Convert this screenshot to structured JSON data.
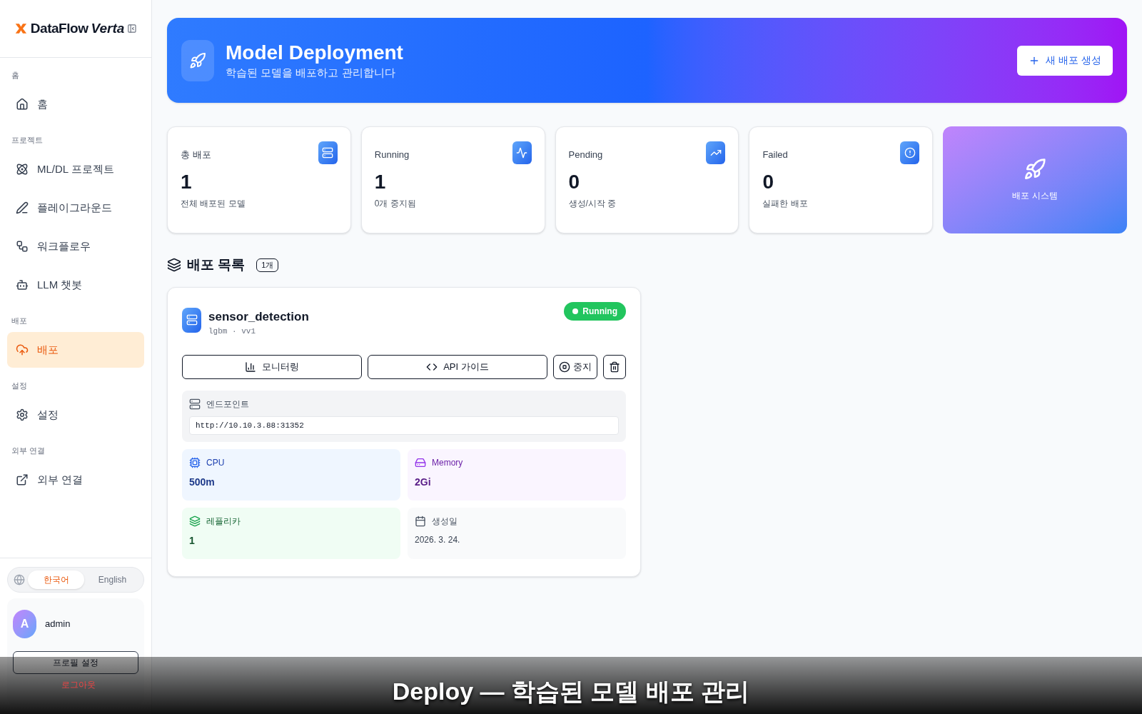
{
  "brand": {
    "name": "DataFlow",
    "accent": "Verta"
  },
  "sidebar": {
    "groups": [
      {
        "label": "홈",
        "items": [
          {
            "kind": "home",
            "label": "홈",
            "selected": false
          }
        ]
      },
      {
        "label": "프로젝트",
        "items": [
          {
            "kind": "atom",
            "label": "ML/DL 프로젝트",
            "selected": false
          },
          {
            "kind": "pen",
            "label": "플레이그라운드",
            "selected": false
          },
          {
            "kind": "flow",
            "label": "워크플로우",
            "selected": false
          },
          {
            "kind": "bot",
            "label": "LLM 챗봇",
            "selected": false
          }
        ]
      },
      {
        "label": "배포",
        "items": [
          {
            "kind": "upload",
            "label": "배포",
            "selected": true
          }
        ]
      },
      {
        "label": "설정",
        "items": [
          {
            "kind": "gear",
            "label": "설정",
            "selected": false
          }
        ]
      },
      {
        "label": "외부 연결",
        "items": [
          {
            "kind": "link",
            "label": "외부 연결",
            "selected": false
          }
        ]
      }
    ]
  },
  "languages": [
    {
      "label": "한국어",
      "selected": true
    },
    {
      "label": "English",
      "selected": false
    }
  ],
  "user": {
    "initial": "A",
    "name": "admin",
    "profile_button": "프로필 설정",
    "logout": "로그아웃"
  },
  "header": {
    "title": "Model Deployment",
    "subtitle": "학습된 모델을 배포하고 관리합니다",
    "new_button": "새 배포 생성"
  },
  "stats": [
    {
      "kind": "server",
      "label": "총 배포",
      "value": "1",
      "note": "전체 배포된 모델"
    },
    {
      "kind": "activity",
      "label": "Running",
      "value": "1",
      "note": "0개 중지됨"
    },
    {
      "kind": "trend",
      "label": "Pending",
      "value": "0",
      "note": "생성/시작 중"
    },
    {
      "kind": "alert",
      "label": "Failed",
      "value": "0",
      "note": "실패한 배포"
    }
  ],
  "system_card": {
    "label": "배포 시스템"
  },
  "list": {
    "title": "배포 목록",
    "count": "1개"
  },
  "deployments": [
    {
      "name": "sensor_detection",
      "meta": "lgbm · vv1",
      "status": "Running",
      "color": "#22c55e",
      "actions": {
        "monitor": "모니터링",
        "api": "API 가이드",
        "stop": "중지"
      },
      "endpoint_label": "엔드포인트",
      "endpoint": "http://10.10.3.88:31352",
      "cpu_label": "CPU",
      "cpu": "500m",
      "memory_label": "Memory",
      "memory": "2Gi",
      "replicas_label": "레플리카",
      "replicas": "1",
      "created_label": "생성일",
      "created": "2026. 3. 24."
    }
  ],
  "caption": "Deploy — 학습된 모델 배포 관리"
}
